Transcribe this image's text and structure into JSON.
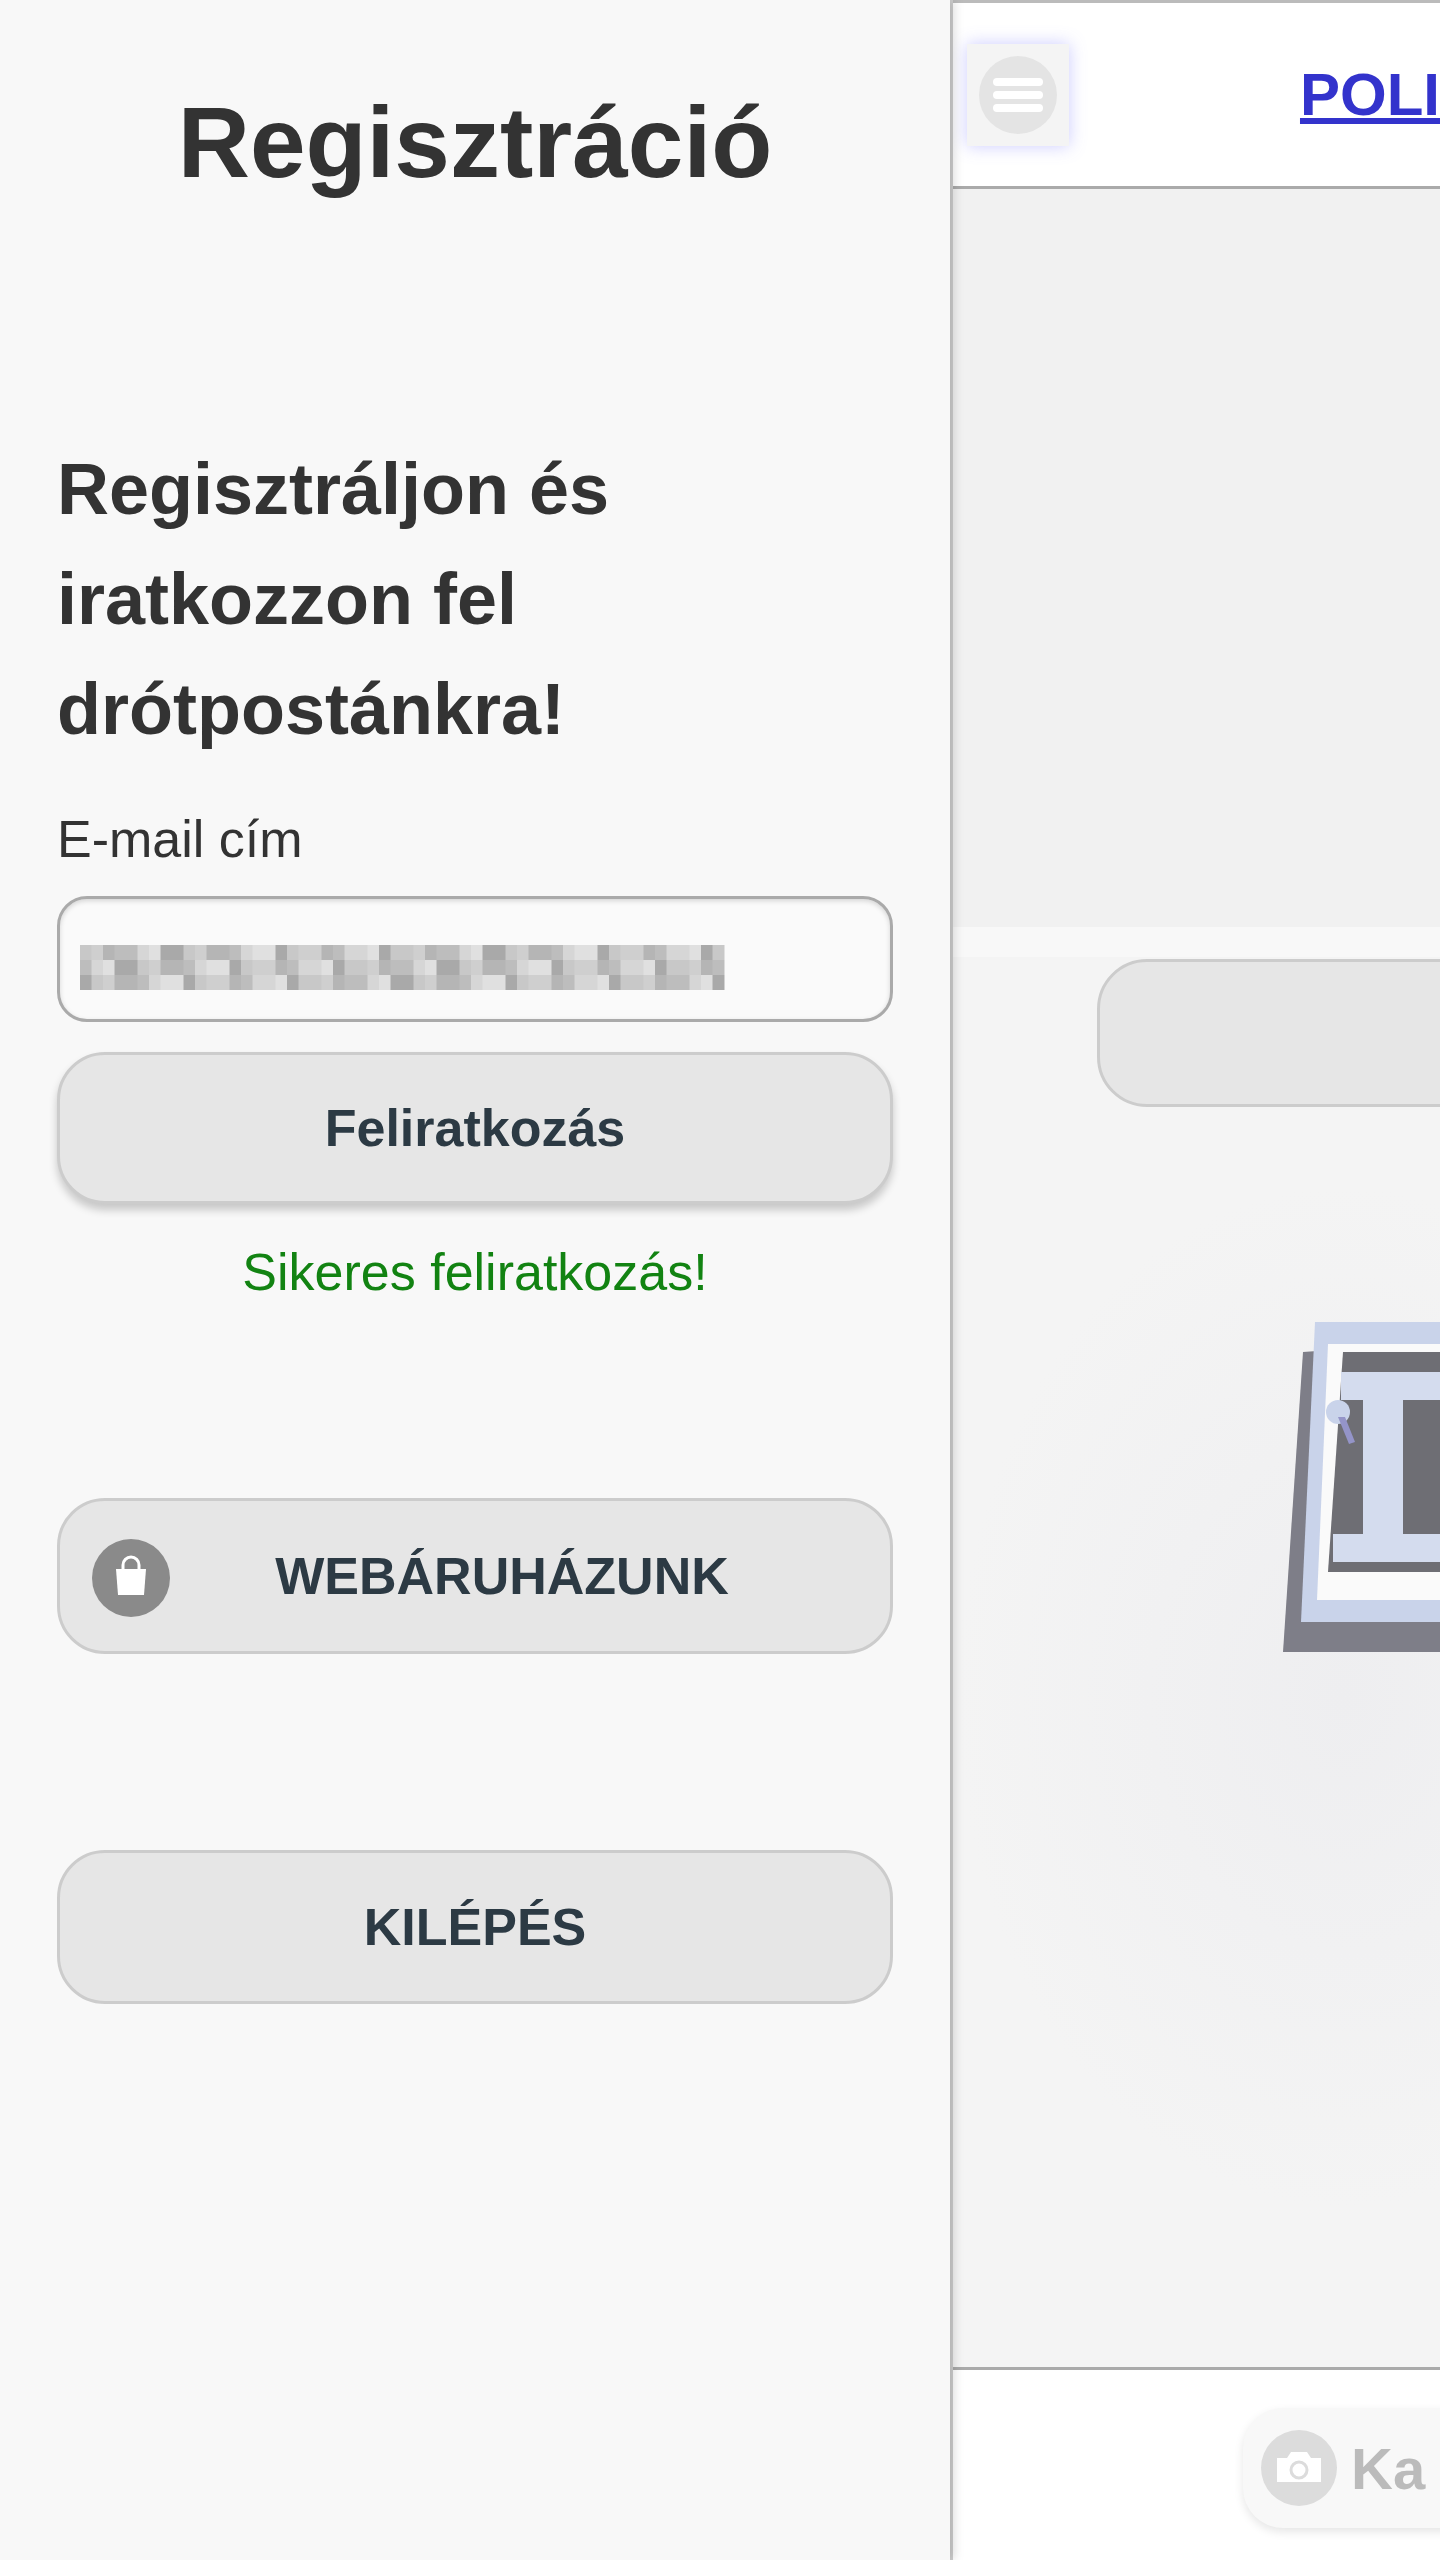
{
  "drawer": {
    "title": "Regisztráció",
    "heading": "Regisztráljon és iratkozzon fel drótpostánkra!",
    "email_label": "E-mail cím",
    "subscribe_button": "Feliratkozás",
    "success_message": "Sikeres feliratkozás!",
    "shop_button": "WEBÁRUHÁZUNK",
    "logout_button": "KILÉPÉS"
  },
  "background_page": {
    "header_link": "POLI",
    "camera_button": "Ka"
  }
}
